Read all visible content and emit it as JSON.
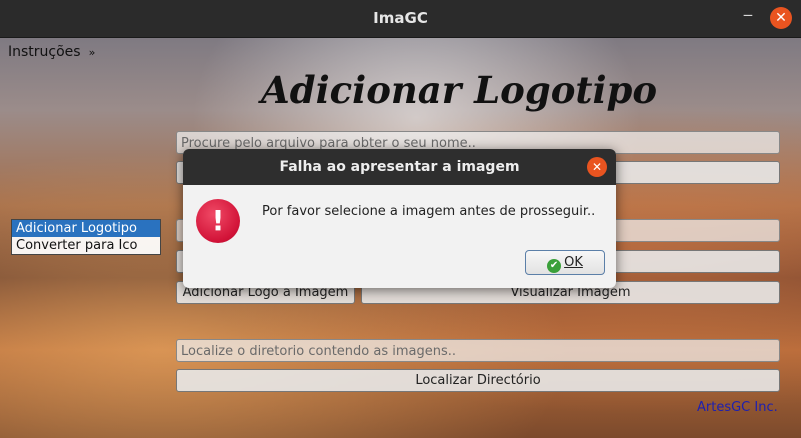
{
  "window": {
    "title": "ImaGC"
  },
  "menu": {
    "label": "Instruções",
    "chevron": "»"
  },
  "heading": "Adicionar Logotipo",
  "form": {
    "file_field_placeholder": "Procure pelo arquivo para obter o seu nome..",
    "add_logo_button": "Adicionar Logo a Imagem",
    "preview_button": "Visualizar Imagem",
    "directory_field_placeholder": "Localize o diretorio contendo as imagens..",
    "locate_directory_button": "Localizar Directório"
  },
  "mode_list": {
    "items": [
      {
        "label": "Adicionar Logotipo",
        "selected": true
      },
      {
        "label": "Converter para Ico",
        "selected": false
      }
    ]
  },
  "credit": "ArtesGC Inc.",
  "dialog": {
    "title": "Falha ao apresentar a imagem",
    "message": "Por favor selecione a imagem antes de prosseguir..",
    "ok_label": "OK",
    "icon": "error-icon"
  },
  "colors": {
    "accent_close": "#e95420",
    "selection": "#2a72bf",
    "credit_text": "#1d1fb0",
    "error_icon": "#d11237"
  }
}
